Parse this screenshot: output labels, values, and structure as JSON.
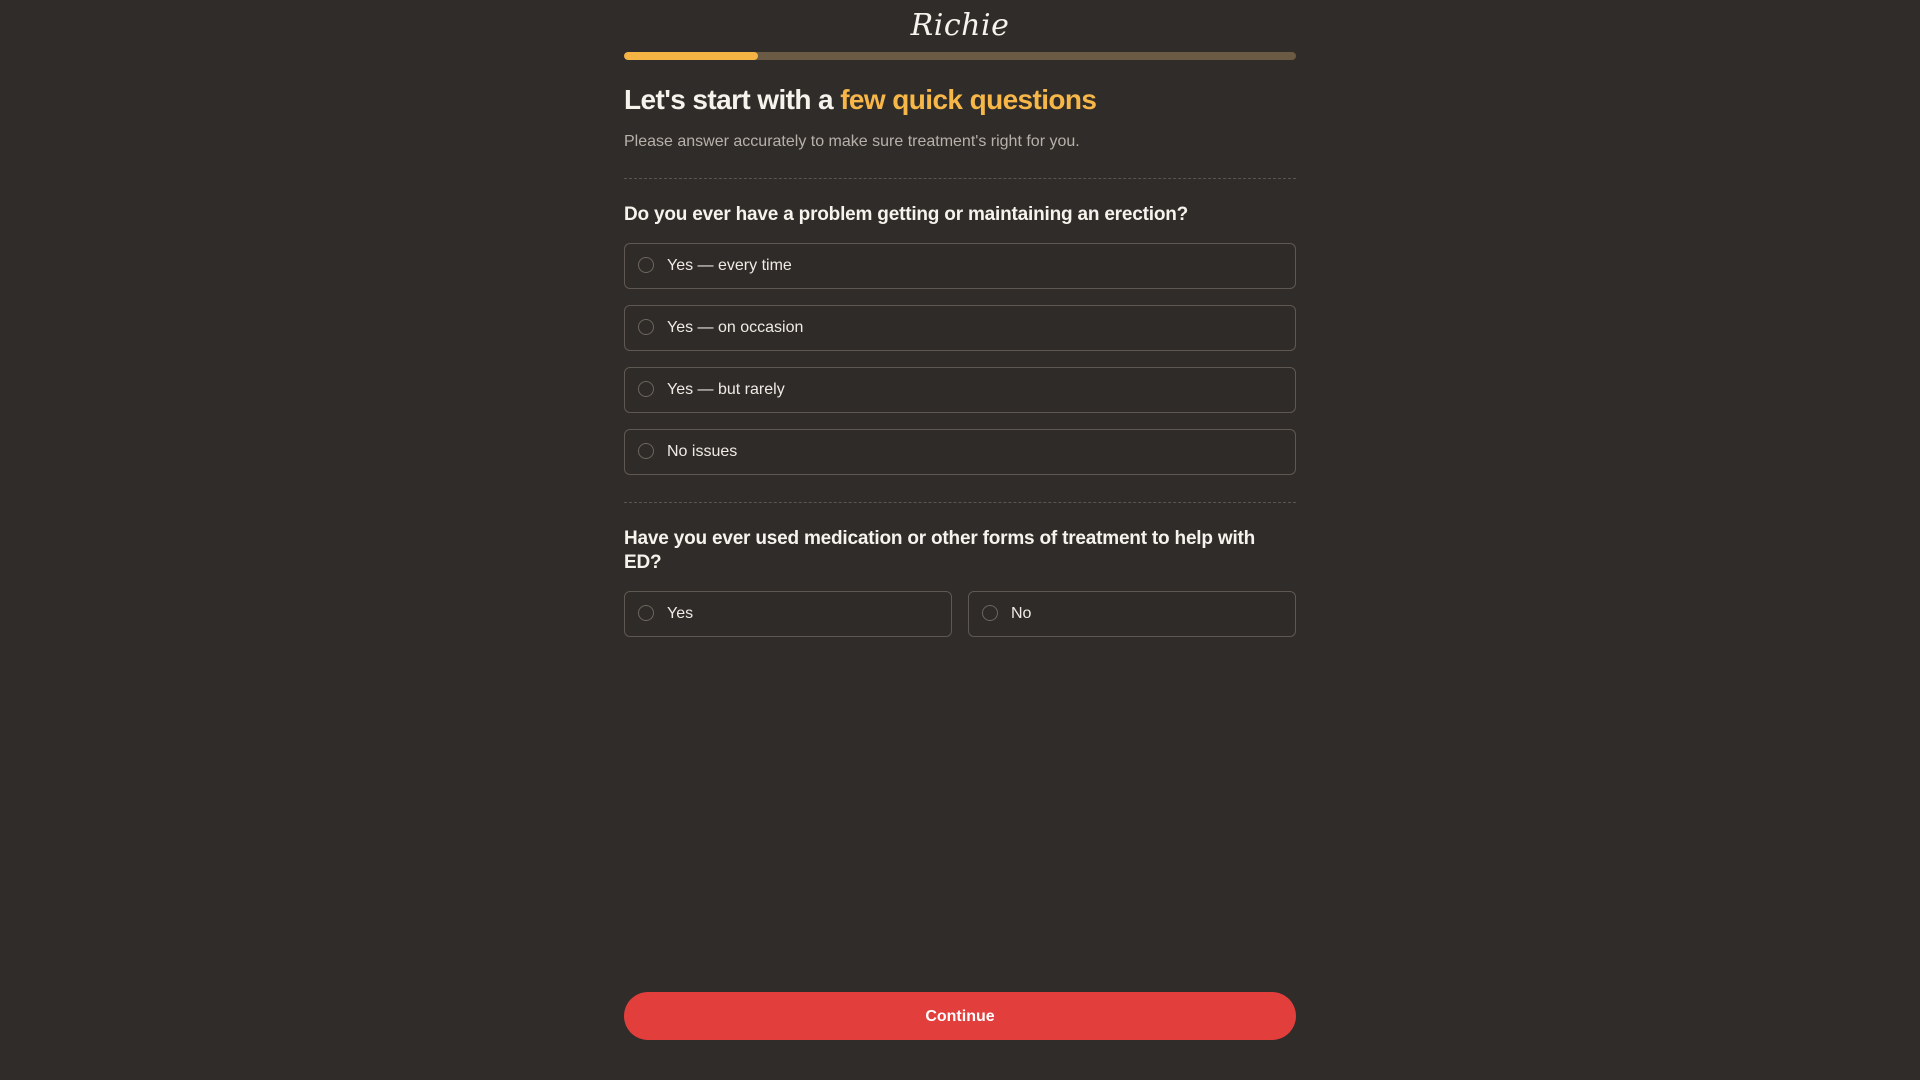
{
  "brand": {
    "logo_text": "Richie"
  },
  "progress": {
    "fraction": 0.2
  },
  "intro": {
    "title_prefix": "Let's start with a ",
    "title_accent": "few quick questions",
    "subtitle": "Please answer accurately to make sure treatment's right for you."
  },
  "questions": [
    {
      "text": "Do you ever have a problem getting or maintaining an erection?",
      "options": [
        "Yes — every time",
        "Yes — on occasion",
        "Yes — but rarely",
        "No issues"
      ]
    },
    {
      "text": "Have you ever used medication or other forms of treatment to help with ED?",
      "options": [
        "Yes",
        "No"
      ]
    }
  ],
  "footer": {
    "continue_label": "Continue"
  },
  "colors": {
    "background": "#302c29",
    "accent": "#f7b748",
    "progress_track": "#6b5a44",
    "cta": "#e23e3c"
  }
}
